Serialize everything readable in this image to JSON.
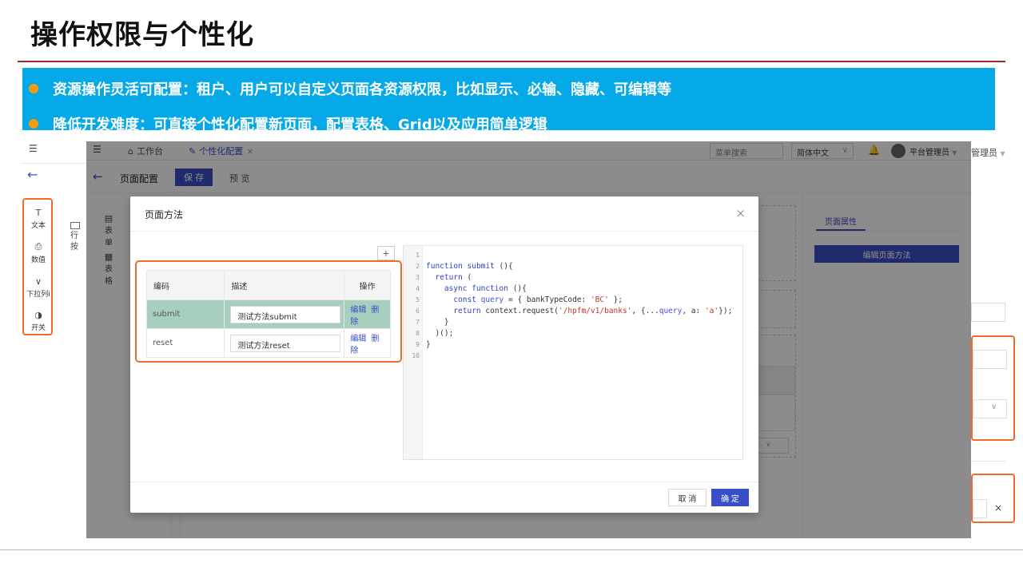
{
  "slide": {
    "title": "操作权限与个性化",
    "bullets": [
      "资源操作灵活可配置：租户、用户可以自定义页面各资源权限，比如显示、必输、隐藏、可编辑等",
      "降低开发难度：可直接个性化配置新页面，配置表格、Grid以及应用简单逻辑"
    ]
  },
  "background": {
    "left_components": [
      {
        "icon": "T",
        "label": "文本"
      },
      {
        "icon": "⎙",
        "label": "数值"
      },
      {
        "icon": "∨",
        "label": "下拉列i"
      },
      {
        "icon": "◑",
        "label": "开关"
      }
    ],
    "left_row_button": "行按",
    "right_user": "管理员",
    "right_close": "×"
  },
  "app": {
    "tabs": {
      "home": "工作台",
      "active": "个性化配置",
      "active_close": "×"
    },
    "menu_search_placeholder": "菜单搜索",
    "language": "简体中文",
    "user": "平台管理员",
    "page_title": "页面配置",
    "save_label": "保 存",
    "preview_label": "预 览",
    "components": [
      {
        "label": "表单"
      },
      {
        "label": "表格"
      }
    ],
    "right_panel": {
      "tab": "页面属性",
      "edit_methods_button": "编辑页面方法"
    }
  },
  "modal": {
    "title": "页面方法",
    "close": "×",
    "add": "+",
    "columns": [
      "编码",
      "描述",
      "操作"
    ],
    "rows": [
      {
        "code": "submit",
        "desc": "测试方法submit",
        "edit": "编辑",
        "delete": "删除",
        "selected": true
      },
      {
        "code": "reset",
        "desc": "测试方法reset",
        "edit": "编辑",
        "delete": "删除",
        "selected": false
      }
    ],
    "cancel_label": "取 消",
    "ok_label": "确 定"
  },
  "colors": {
    "accent": "#3a4fc7",
    "banner": "#05a9e8",
    "highlight_border": "#ee6b2d",
    "title_rule": "#a4262c",
    "selected_row": "#a8cfbd"
  }
}
